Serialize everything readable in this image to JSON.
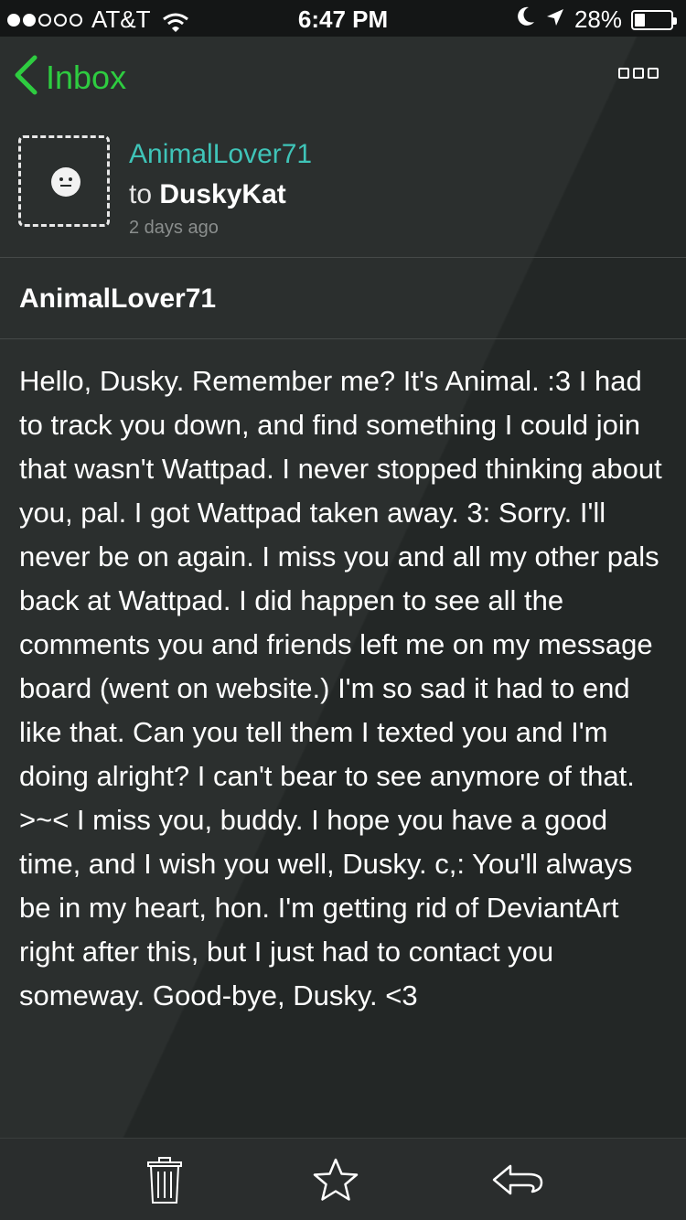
{
  "status_bar": {
    "carrier": "AT&T",
    "time": "6:47 PM",
    "battery": "28%",
    "battery_level": 0.28,
    "signal_bars_filled": 2,
    "signal_bars_total": 5
  },
  "nav": {
    "back_label": "Inbox",
    "more_icon": "more-icon"
  },
  "message": {
    "sender": "AnimalLover71",
    "to_word": "to",
    "recipient": "DuskyKat",
    "time_ago": "2 days ago",
    "subject": "AnimalLover71",
    "body": "Hello, Dusky. Remember me? It's Animal. :3 I had to track you down, and find something I could join that wasn't Wattpad. I never stopped thinking about you, pal. I got Wattpad taken away. 3: Sorry. I'll never be on again. I miss you and all my other pals back at Wattpad. I did happen to see all the comments you and friends left me on my message board (went on website.) I'm so sad it had to end like that. Can you tell them I texted you and I'm doing alright? I can't bear to see anymore of that. >~< I miss you, buddy. I hope you have a good time, and I wish you well, Dusky. c,: You'll always be in my heart, hon. I'm getting rid of DeviantArt right after this, but I just had to contact you someway. Good-bye, Dusky. <3"
  },
  "toolbar": {
    "icons": [
      "trash-icon",
      "star-icon",
      "reply-icon"
    ]
  },
  "colors": {
    "accent_green": "#2ecc40",
    "sender_teal": "#3fc4b8",
    "background": "#262a29",
    "status_bar": "#141616"
  }
}
